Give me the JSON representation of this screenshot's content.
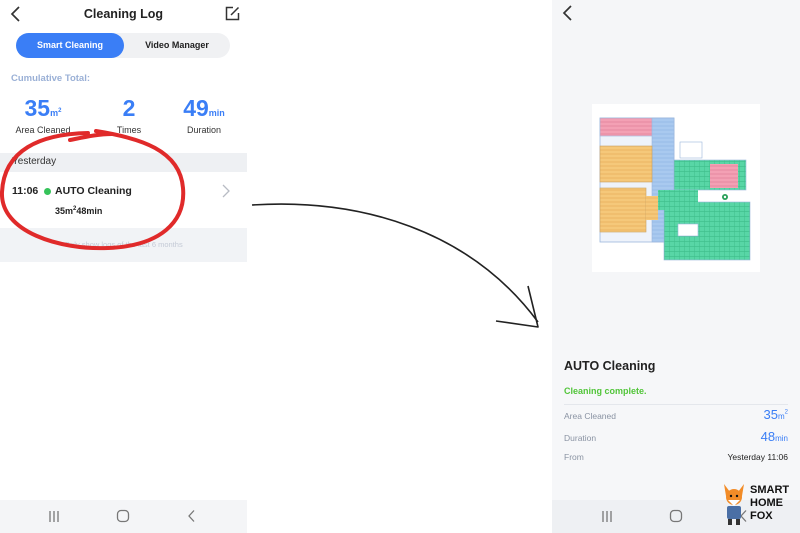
{
  "left": {
    "title": "Cleaning Log",
    "tabs": [
      {
        "label": "Smart Cleaning",
        "active": true
      },
      {
        "label": "Video Manager",
        "active": false
      }
    ],
    "cumulative_label": "Cumulative Total:",
    "stats": [
      {
        "value": "35",
        "unit": "m",
        "unit_sup": "2",
        "label": "Area Cleaned"
      },
      {
        "value": "2",
        "unit": "",
        "unit_sup": "",
        "label": "Times"
      },
      {
        "value": "49",
        "unit": "min",
        "unit_sup": "",
        "label": "Duration"
      }
    ],
    "day_group": "Yesterday",
    "record": {
      "time": "11:06",
      "name": "AUTO Cleaning",
      "area_value": "35m",
      "area_sup": "2",
      "duration": "48min"
    },
    "note": "Only show logs of the last 6 months"
  },
  "right": {
    "title": "AUTO Cleaning",
    "status": "Cleaning complete.",
    "rows": [
      {
        "label": "Area Cleaned",
        "value": "35",
        "unit": "m",
        "unit_sup": "2"
      },
      {
        "label": "Duration",
        "value": "48",
        "unit": "min",
        "unit_sup": ""
      },
      {
        "label": "From",
        "value": "Yesterday 11:06"
      }
    ]
  },
  "brand": {
    "line1": "SMART",
    "line2": "HOME",
    "line3": "FOX"
  },
  "colors": {
    "accent": "#3a7ef6",
    "status_green": "#52c53a",
    "dot_green": "#36c35a",
    "annotation_red": "#e02a2a"
  },
  "icons": [
    "back-icon",
    "edit-icon",
    "chevron-right-icon",
    "recents-icon",
    "home-icon",
    "back-nav-icon"
  ]
}
